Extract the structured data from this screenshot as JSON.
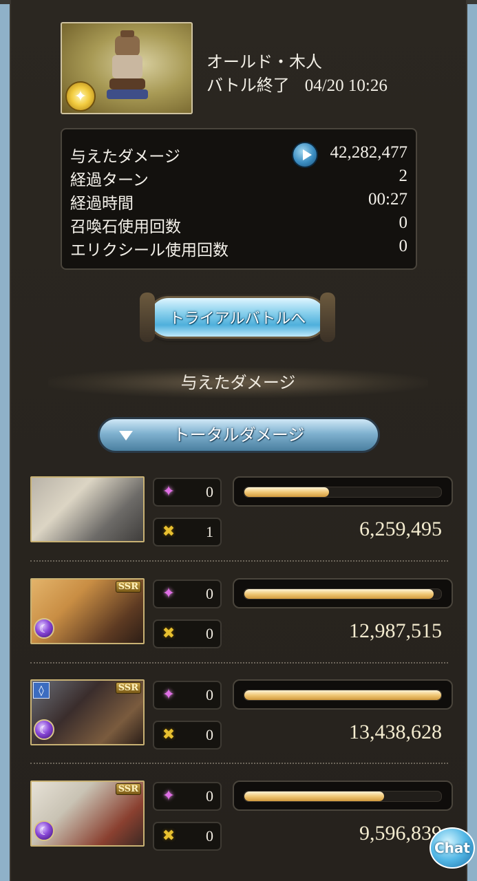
{
  "battle": {
    "boss_name": "オールド・木人",
    "status_label": "バトル終了",
    "timestamp": "04/20 10:26"
  },
  "stats": [
    {
      "label": "与えたダメージ",
      "value": "42,282,477"
    },
    {
      "label": "経過ターン",
      "value": "2"
    },
    {
      "label": "経過時間",
      "value": "00:27"
    },
    {
      "label": "召喚石使用回数",
      "value": "0"
    },
    {
      "label": "エリクシール使用回数",
      "value": "0"
    }
  ],
  "trial_button_label": "トライアルバトルへ",
  "section_title": "与えたダメージ",
  "damage_dropdown_label": "トータルダメージ",
  "characters": [
    {
      "ougi": "0",
      "chain": "1",
      "damage": "6,259,495",
      "fill": 0.43,
      "rarity": ""
    },
    {
      "ougi": "0",
      "chain": "0",
      "damage": "12,987,515",
      "fill": 0.96,
      "rarity": "SSR"
    },
    {
      "ougi": "0",
      "chain": "0",
      "damage": "13,438,628",
      "fill": 1.0,
      "rarity": "SSR"
    },
    {
      "ougi": "0",
      "chain": "0",
      "damage": "9,596,839",
      "fill": 0.71,
      "rarity": "SSR"
    }
  ],
  "chat_label": "Chat"
}
